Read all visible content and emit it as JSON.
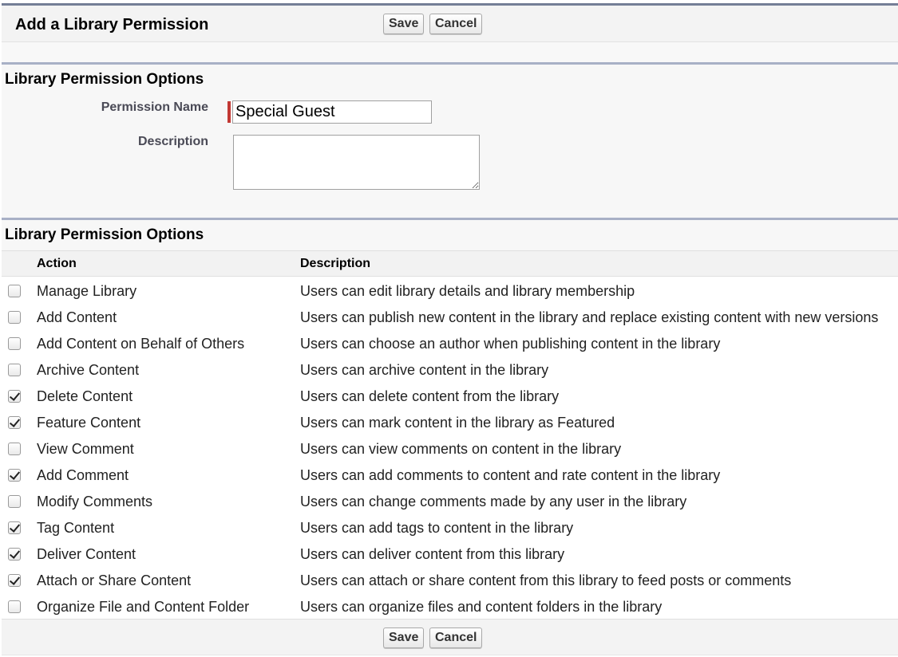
{
  "header": {
    "title": "Add a Library Permission",
    "save_label": "Save",
    "cancel_label": "Cancel"
  },
  "details_section": {
    "title": "Library Permission Options",
    "permission_name_label": "Permission Name",
    "permission_name_value": "Special Guest",
    "description_label": "Description",
    "description_value": ""
  },
  "options_section": {
    "title": "Library Permission Options",
    "columns": [
      "Action",
      "Description"
    ],
    "rows": [
      {
        "action": "Manage Library",
        "description": "Users can edit library details and library membership",
        "checked": false
      },
      {
        "action": "Add Content",
        "description": "Users can publish new content in the library and replace existing content with new versions",
        "checked": false
      },
      {
        "action": "Add Content on Behalf of Others",
        "description": "Users can choose an author when publishing content in the library",
        "checked": false
      },
      {
        "action": "Archive Content",
        "description": "Users can archive content in the library",
        "checked": false
      },
      {
        "action": "Delete Content",
        "description": "Users can delete content from the library",
        "checked": true
      },
      {
        "action": "Feature Content",
        "description": "Users can mark content in the library as Featured",
        "checked": true
      },
      {
        "action": "View Comment",
        "description": "Users can view comments on content in the library",
        "checked": false
      },
      {
        "action": "Add Comment",
        "description": "Users can add comments to content and rate content in the library",
        "checked": true
      },
      {
        "action": "Modify Comments",
        "description": "Users can change comments made by any user in the library",
        "checked": false
      },
      {
        "action": "Tag Content",
        "description": "Users can add tags to content in the library",
        "checked": true
      },
      {
        "action": "Deliver Content",
        "description": "Users can deliver content from this library",
        "checked": true
      },
      {
        "action": "Attach or Share Content",
        "description": "Users can attach or share content from this library to feed posts or comments",
        "checked": true
      },
      {
        "action": "Organize File and Content Folder",
        "description": "Users can organize files and content folders in the library",
        "checked": false
      }
    ]
  },
  "footer": {
    "save_label": "Save",
    "cancel_label": "Cancel"
  },
  "colors": {
    "required_indicator": "#c23934",
    "section_border": "#a8b0c6",
    "header_border": "#747e96"
  }
}
